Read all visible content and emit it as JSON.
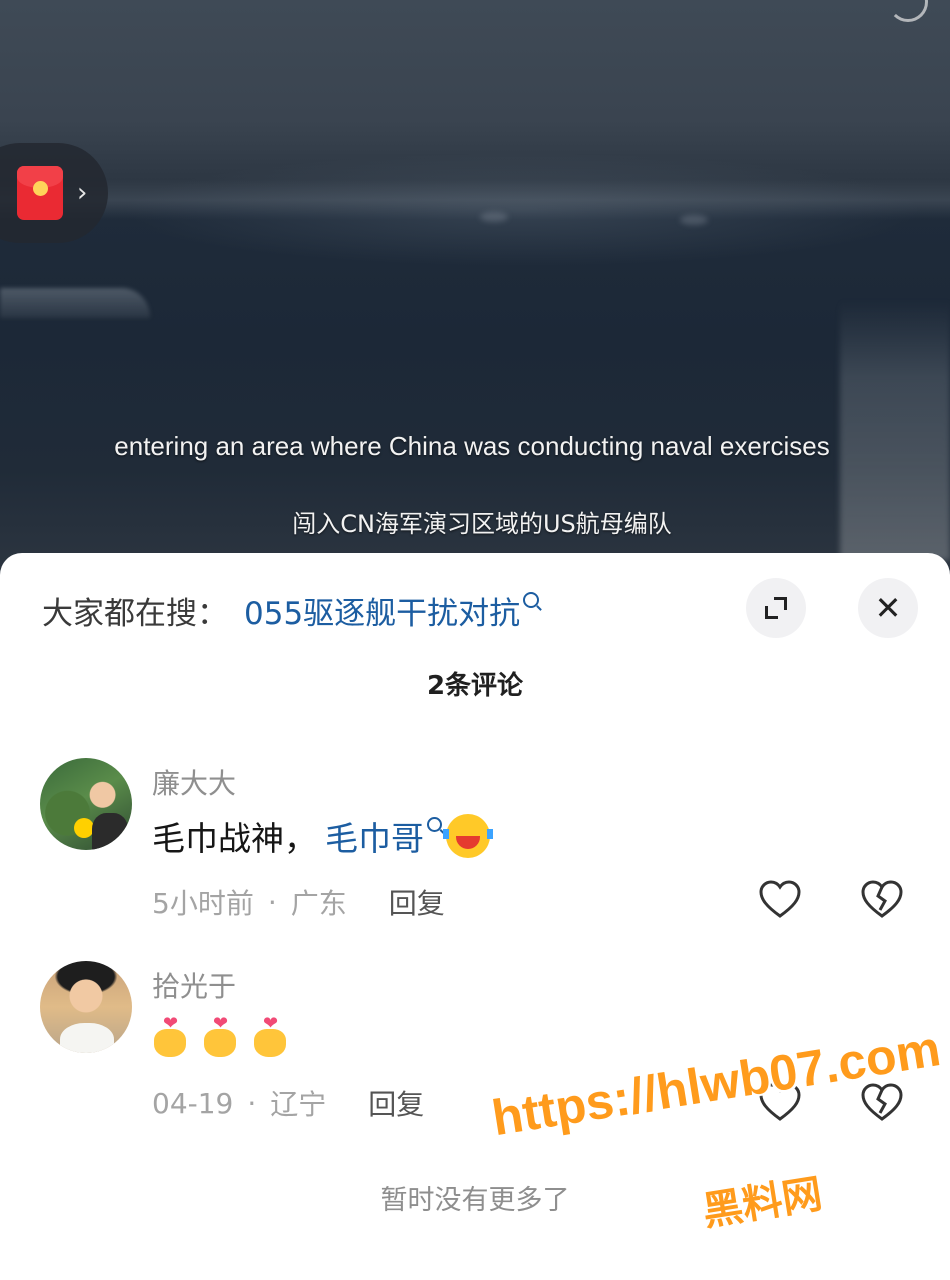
{
  "video": {
    "subtitle_en": "entering an area where China was conducting naval exercises",
    "subtitle_cn": "闯入CN海军演习区域的US航母编队",
    "redpack_icon": "red-envelope-icon"
  },
  "search_suggest": {
    "prefix": "大家都在搜：",
    "term": "055驱逐舰干扰对抗"
  },
  "comments_header": {
    "count_label": "2条评论"
  },
  "comments": [
    {
      "name": "廉大大",
      "text": "毛巾战神，",
      "link": "毛巾哥",
      "time": "5小时前",
      "location": "广东",
      "reply": "回复"
    },
    {
      "name": "拾光于",
      "text": "",
      "emojis": [
        "heart-hands",
        "heart-hands",
        "heart-hands"
      ],
      "time": "04-19",
      "location": "辽宁",
      "reply": "回复"
    }
  ],
  "footer": {
    "no_more": "暂时没有更多了"
  },
  "watermark": {
    "url": "https://hlwb07.com",
    "name": "黑料网"
  },
  "colors": {
    "link": "#1c5da1",
    "watermark": "#ff9b1c",
    "redpack": "#ea2a33"
  }
}
